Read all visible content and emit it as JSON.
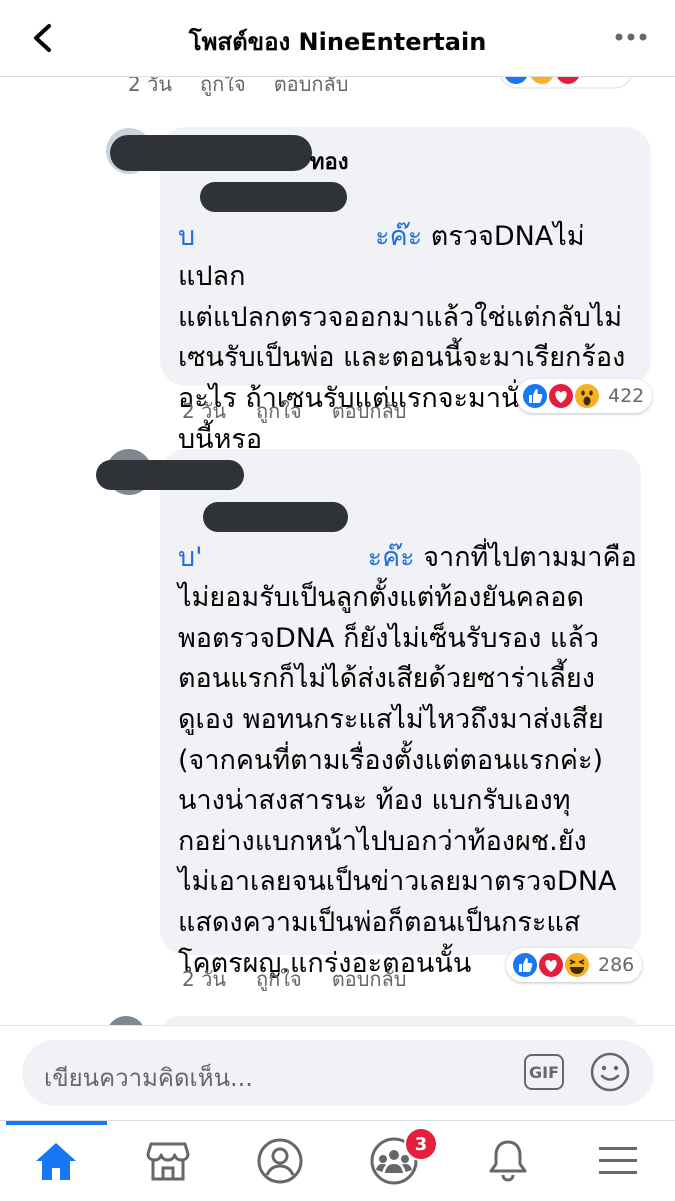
{
  "header": {
    "title": "โพสต์ของ NineEntertain"
  },
  "top_comment": {
    "time": "2 วัน",
    "like": "ถูกใจ",
    "reply": "ตอบกลับ"
  },
  "comments": [
    {
      "name_suffix": "ทอง",
      "mention_prefix": "บ",
      "mention_suffix": "ะค๊ะ",
      "text_first": " ตรวจDNAไม่แปลก",
      "text_rest": "แต่แปลกตรวจออกมาแล้วใช่แต่กลับไม่\nเซนรับเป็นพ่อ และตอนนี้จะมาเรียกร้อง\nอะไร ถ้าเซนรับแต่แรกจะมานั่งฟ้องแบ\nบนี้หรอ",
      "time": "2 วัน",
      "like": "ถูกใจ",
      "reply": "ตอบกลับ",
      "reaction_count": "422",
      "reactions": [
        "like-icon",
        "love-icon",
        "wow-icon"
      ]
    },
    {
      "mention_prefix": "บ'",
      "mention_suffix": "ะค๊ะ",
      "text_first": " จากที่ไปตามมาคือ",
      "text_rest": "ไม่ยอมรับเป็นลูกตั้งแต่ท้องยันคลอด\nพอตรวจDNA ก็ยังไม่เซ็นรับรอง แล้ว\nตอนแรกก็ไม่ได้ส่งเสียด้วยซาร่าเลี้ยง\nดูเอง พอทนกระแสไม่ไหวถึงมาส่งเสีย\n(จากคนที่ตามเรื่องตั้งแต่ตอนแรกค่ะ)\nนางน่าสงสารนะ ท้อง แบกรับเองทุ\nกอย่างแบกหน้าไปบอกว่าท้องผช.ยัง\nไม่เอาเลยจนเป็นข่าวเลยมาตรวจDNA\nแสดงความเป็นพ่อก็ตอนเป็นกระแส\nโคตรผญ.แกร่งอะตอนนั้น",
      "time": "2 วัน",
      "like": "ถูกใจ",
      "reply": "ตอบกลับ",
      "reaction_count": "286",
      "reactions": [
        "like-icon",
        "love-icon",
        "haha-icon"
      ]
    }
  ],
  "composer": {
    "placeholder": "เขียนความคิดเห็น...",
    "gif_label": "GIF"
  },
  "nav": {
    "items": [
      "home-icon",
      "marketplace-icon",
      "profile-icon",
      "groups-icon",
      "notifications-icon",
      "menu-icon"
    ],
    "groups_badge": "3"
  },
  "colors": {
    "accent": "#1877f2",
    "mention": "#216fdb",
    "bubble": "#f0f2f5",
    "meta": "#65676b"
  }
}
